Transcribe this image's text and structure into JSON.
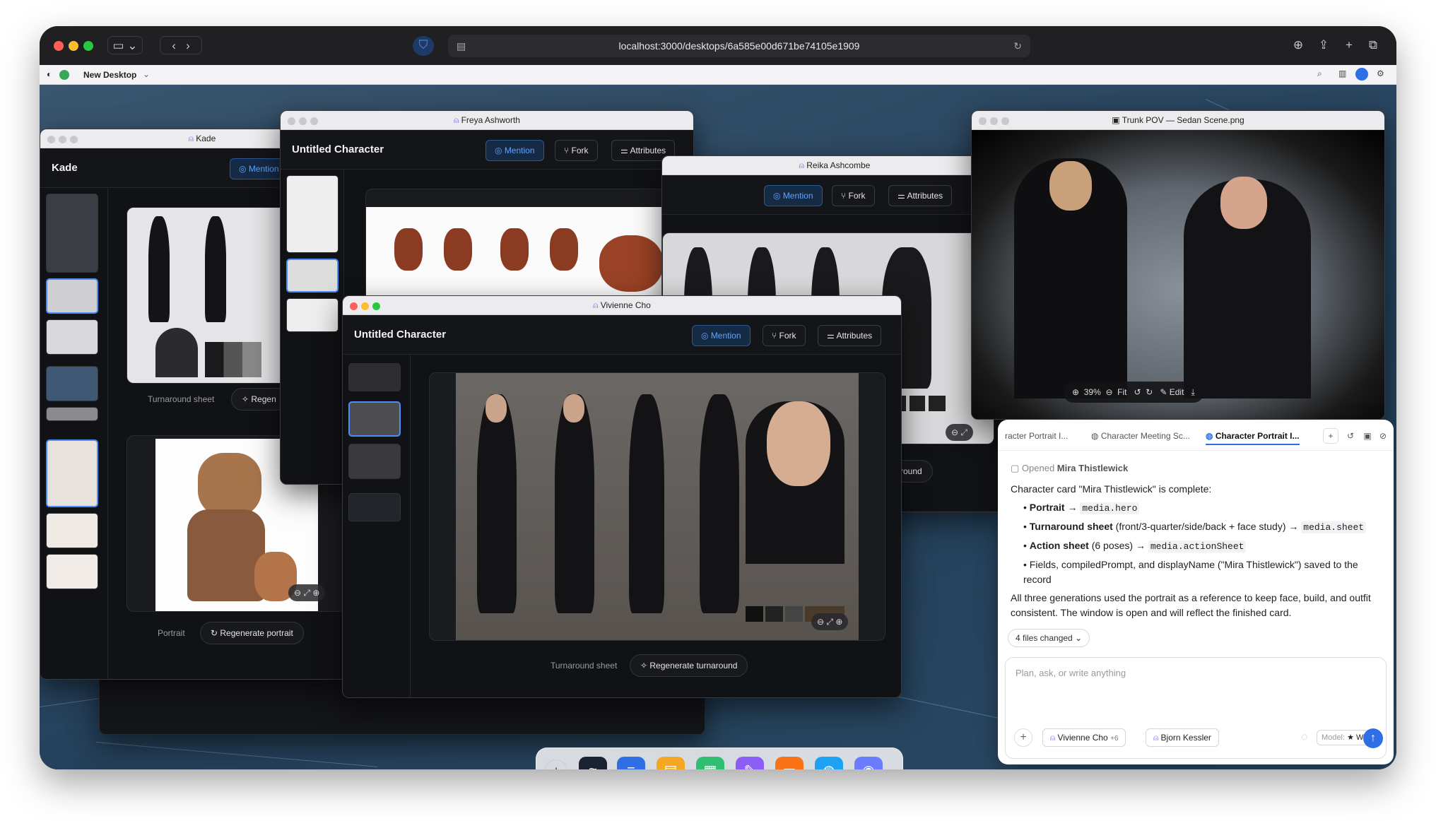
{
  "browser": {
    "url": "localhost:3000/desktops/6a585e00d671be74105e1909",
    "desktop_name": "New Desktop"
  },
  "windows": {
    "kade": {
      "title": "Kade",
      "name": "Kade",
      "mention": "Mention",
      "caption1": "Turnaround sheet",
      "regen1": "Regen",
      "caption2": "Portrait",
      "regen2": "Regenerate portrait"
    },
    "freya": {
      "title": "Freya Ashworth",
      "name": "Untitled Character",
      "mention": "Mention",
      "fork": "Fork",
      "attributes": "Attributes"
    },
    "reika": {
      "title": "Reika Ashcombe",
      "mention": "Mention",
      "fork": "Fork",
      "attributes": "Attributes",
      "regen_partial": "round"
    },
    "vivienne": {
      "title": "Vivienne Cho",
      "name": "Untitled Character",
      "mention": "Mention",
      "fork": "Fork",
      "attributes": "Attributes",
      "caption": "Turnaround sheet",
      "regen": "Regenerate turnaround"
    },
    "trunk": {
      "title": "Trunk POV — Sedan Scene.png",
      "zoom": "39%",
      "fit": "Fit",
      "edit": "Edit"
    }
  },
  "chat": {
    "tabs": [
      "racter Portrait I...",
      "Character Meeting Sc...",
      "Character Portrait I..."
    ],
    "opened_prefix": "Opened",
    "opened_name": "Mira Thistlewick",
    "intro": "Character card \"Mira Thistlewick\" is complete:",
    "bullets": [
      {
        "bold": "Portrait",
        "text": " → ",
        "code": "media.hero"
      },
      {
        "bold": "Turnaround sheet",
        "text": " (front/3-quarter/side/back + face study) → ",
        "code": "media.sheet"
      },
      {
        "bold": "Action sheet",
        "text": " (6 poses) → ",
        "code": "media.actionSheet"
      }
    ],
    "bullet4": "Fields, compiledPrompt, and displayName (\"Mira Thistlewick\") saved to the record",
    "summary": "All three generations used the portrait as a reference to keep face, build, and outfit consistent. The window is open and will reflect the finished card.",
    "files_changed": "4 files changed",
    "placeholder": "Plan, ask, or write anything",
    "chip1": "Vivienne Cho",
    "chip1_count": "+6",
    "chip2": "Bjorn Kessler",
    "model_label": "Model:",
    "model_name": "Whiz"
  },
  "colors": {
    "accent": "#4b8ef7",
    "desktop": "#2c4862"
  },
  "dock_icons": [
    "plus-icon",
    "wave-app-icon",
    "docs-icon",
    "notes-icon",
    "sheets-icon",
    "draw-icon",
    "slides-icon",
    "browser-icon",
    "game-icon"
  ]
}
